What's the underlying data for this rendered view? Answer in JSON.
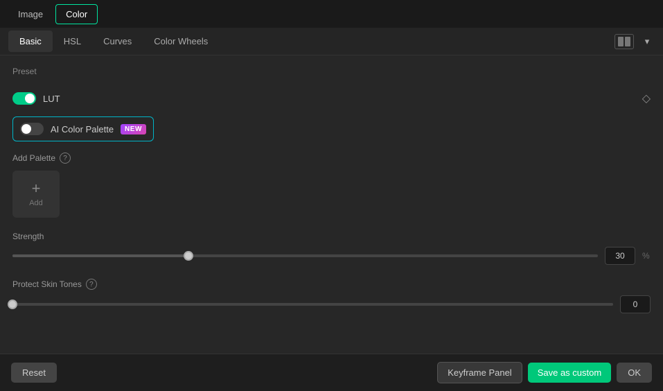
{
  "topBar": {
    "imageLabel": "Image",
    "colorLabel": "Color"
  },
  "subTabs": {
    "tabs": [
      {
        "label": "Basic",
        "active": true
      },
      {
        "label": "HSL",
        "active": false
      },
      {
        "label": "Curves",
        "active": false
      },
      {
        "label": "Color Wheels",
        "active": false
      }
    ]
  },
  "preset": {
    "sectionLabel": "Preset",
    "lut": {
      "label": "LUT",
      "enabled": true
    },
    "aiColorPalette": {
      "label": "AI Color Palette",
      "badge": "NEW",
      "enabled": false
    }
  },
  "palette": {
    "label": "Add Palette",
    "addButtonLabel": "Add"
  },
  "strength": {
    "label": "Strength",
    "value": "30",
    "unit": "%",
    "percent": 30
  },
  "protectSkinTones": {
    "label": "Protect Skin Tones",
    "value": "0",
    "percent": 0,
    "hasInfo": true
  },
  "bottomBar": {
    "resetLabel": "Reset",
    "keyframeLabel": "Keyframe Panel",
    "saveCustomLabel": "Save as custom",
    "okLabel": "OK"
  },
  "icons": {
    "info": "?",
    "diamond": "◇",
    "chevronDown": "▾",
    "plus": "+"
  }
}
